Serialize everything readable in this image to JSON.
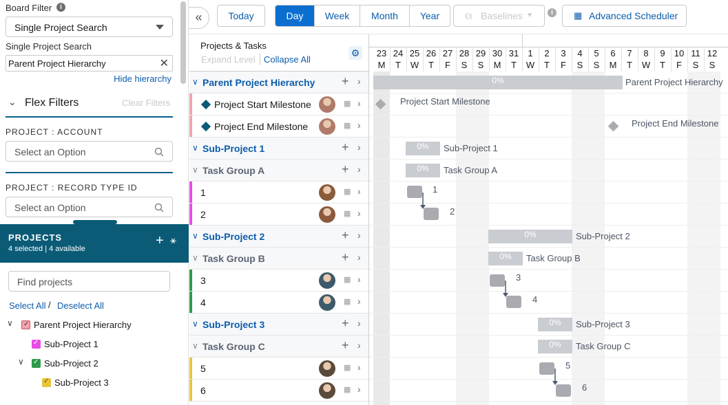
{
  "left": {
    "board_filter_label": "Board Filter",
    "board_filter_value": "Single Project Search",
    "single_search_label": "Single Project Search",
    "single_search_value": "Parent Project Hierarchy",
    "hide_hierarchy": "Hide hierarchy",
    "flex_filters": "Flex Filters",
    "clear_filters": "Clear Filters",
    "account_label": "PROJECT : ACCOUNT",
    "account_placeholder": "Select an Option",
    "recordtype_label": "PROJECT : RECORD TYPE ID",
    "recordtype_placeholder": "Select an Option"
  },
  "projects": {
    "title": "PROJECTS",
    "summary": "4 selected | 4 available",
    "find_placeholder": "Find projects",
    "select_all": "Select All",
    "slash": "/",
    "deselect_all": "Deselect All",
    "tree": [
      {
        "label": "Parent Project Hierarchy",
        "color": "#f0a3ad"
      },
      {
        "label": "Sub-Project 1",
        "color": "#e84ce6"
      },
      {
        "label": "Sub-Project 2",
        "color": "#2e9a4a"
      },
      {
        "label": "Sub-Project 3",
        "color": "#e8c43c"
      }
    ]
  },
  "toolbar": {
    "today": "Today",
    "views": [
      "Day",
      "Week",
      "Month",
      "Year"
    ],
    "active_view": "Day",
    "baselines": "Baselines",
    "advanced_scheduler": "Advanced Scheduler"
  },
  "grid": {
    "header": "Projects & Tasks",
    "expand_level": "Expand Level",
    "collapse_all": "Collapse All",
    "rows": [
      {
        "name": "Parent Project Hierarchy",
        "kind": "group"
      },
      {
        "name": "Project Start Milestone",
        "kind": "milestone"
      },
      {
        "name": "Project End Milestone",
        "kind": "milestone"
      },
      {
        "name": "Sub-Project 1",
        "kind": "group"
      },
      {
        "name": "Task Group A",
        "kind": "taskgroup"
      },
      {
        "name": "1",
        "kind": "task"
      },
      {
        "name": "2",
        "kind": "task"
      },
      {
        "name": "Sub-Project 2",
        "kind": "group"
      },
      {
        "name": "Task Group B",
        "kind": "taskgroup"
      },
      {
        "name": "3",
        "kind": "task"
      },
      {
        "name": "4",
        "kind": "task"
      },
      {
        "name": "Sub-Project 3",
        "kind": "group"
      },
      {
        "name": "Task Group C",
        "kind": "taskgroup"
      },
      {
        "name": "5",
        "kind": "task"
      },
      {
        "name": "6",
        "kind": "task"
      }
    ]
  },
  "timeline": {
    "days": [
      "23",
      "24",
      "25",
      "26",
      "27",
      "28",
      "29",
      "30",
      "31",
      "1",
      "2",
      "3",
      "4",
      "5",
      "6",
      "7",
      "8",
      "9",
      "10",
      "11",
      "12"
    ],
    "weekdays": [
      "M",
      "T",
      "W",
      "T",
      "F",
      "S",
      "S",
      "M",
      "T",
      "W",
      "T",
      "F",
      "S",
      "S",
      "M",
      "T",
      "W",
      "T",
      "F",
      "S",
      "S"
    ],
    "pct": "0%",
    "bar_labels": {
      "parent": "Parent Project Hierarchy",
      "start_ms": "Project Start Milestone",
      "end_ms": "Project End Milestone",
      "sp1": "Sub-Project 1",
      "tga": "Task Group A",
      "t1": "1",
      "t2": "2",
      "sp2": "Sub-Project 2",
      "tgb": "Task Group B",
      "t3": "3",
      "t4": "4",
      "sp3": "Sub-Project 3",
      "tgc": "Task Group C",
      "t5": "5",
      "t6": "6"
    }
  },
  "colors": {
    "accent": "#0b6fd0",
    "teal": "#0b5b77",
    "milestone": "#0b5b77"
  }
}
